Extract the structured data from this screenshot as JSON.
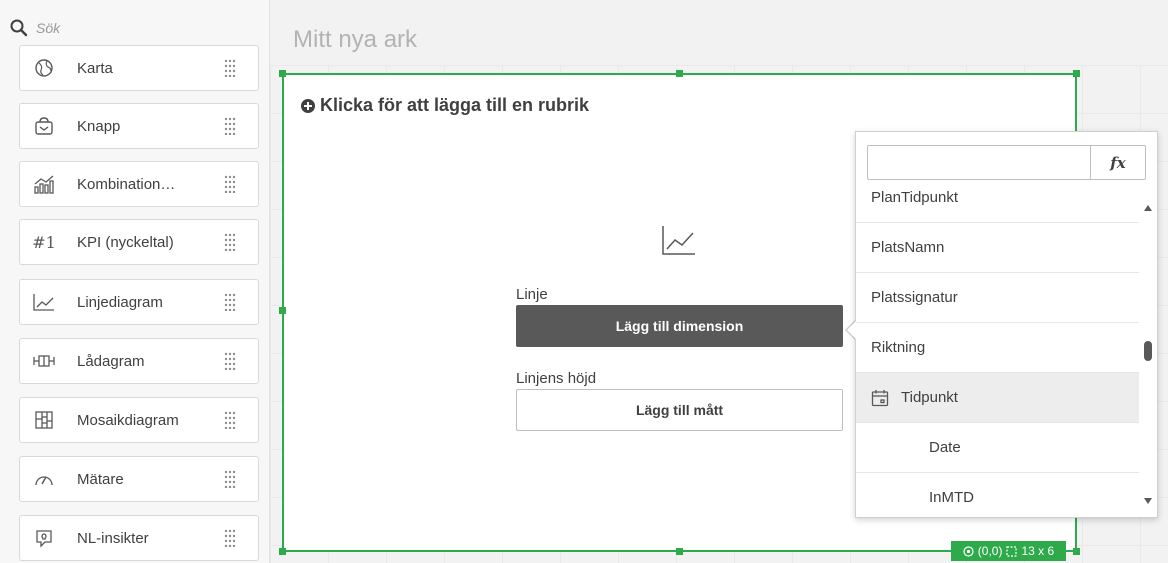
{
  "search": {
    "placeholder": "Sök",
    "icon": "search-icon"
  },
  "panel_items": [
    {
      "label": "Karta",
      "icon": "map-icon"
    },
    {
      "label": "Knapp",
      "icon": "button-icon"
    },
    {
      "label": "Kombination…",
      "icon": "combo-chart-icon"
    },
    {
      "label": "KPI (nyckeltal)",
      "icon": "kpi-icon",
      "glyph": "#1"
    },
    {
      "label": "Linjediagram",
      "icon": "line-chart-icon"
    },
    {
      "label": "Lådagram",
      "icon": "box-plot-icon"
    },
    {
      "label": "Mosaikdiagram",
      "icon": "mekko-chart-icon"
    },
    {
      "label": "Mätare",
      "icon": "gauge-icon"
    },
    {
      "label": "NL-insikter",
      "icon": "insights-icon"
    }
  ],
  "sheet": {
    "title": "Mitt nya ark"
  },
  "object": {
    "title_prompt": "Klicka för att lägga till en rubrik",
    "dimension_label": "Linje",
    "dimension_button": "Lägg till dimension",
    "measure_label": "Linjens höjd",
    "measure_button": "Lägg till mått",
    "position": "(0,0)",
    "size": "13 x 6",
    "accent_color": "#2eaa4b"
  },
  "field_picker": {
    "search_value": "",
    "fx_label": "fx",
    "fields": [
      {
        "label": "PlanTidpunkt",
        "type": "field"
      },
      {
        "label": "PlatsNamn",
        "type": "field"
      },
      {
        "label": "Platssignatur",
        "type": "field"
      },
      {
        "label": "Riktning",
        "type": "field"
      },
      {
        "label": "Tidpunkt",
        "type": "date-field",
        "icon": "calendar-icon"
      },
      {
        "label": "Date",
        "type": "sub-field"
      },
      {
        "label": "InMTD",
        "type": "sub-field"
      }
    ]
  }
}
